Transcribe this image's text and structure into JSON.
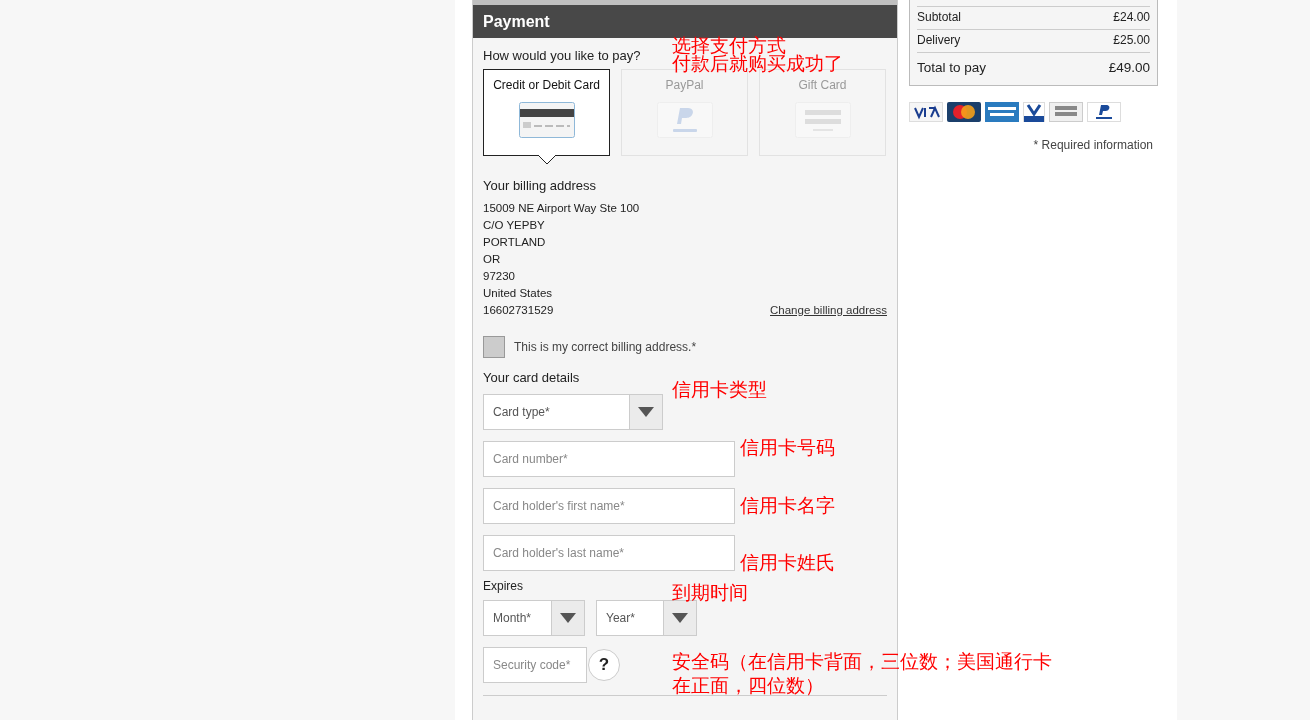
{
  "payment": {
    "title": "Payment",
    "question": "How would you like to pay?",
    "methods": [
      {
        "label": "Credit or Debit Card",
        "kind": "card",
        "selected": true
      },
      {
        "label": "PayPal",
        "kind": "paypal",
        "selected": false
      },
      {
        "label": "Gift Card",
        "kind": "gift",
        "selected": false
      }
    ],
    "billing": {
      "heading": "Your billing address",
      "lines": [
        "15009 NE Airport Way Ste 100",
        "C/O YEPBY",
        "PORTLAND",
        "OR",
        "97230",
        "United States",
        "16602731529"
      ],
      "change_link": "Change billing address"
    },
    "confirm": {
      "label": "This is my correct billing address.*",
      "checked": false
    },
    "card_details": {
      "heading": "Your card details",
      "card_type": {
        "placeholder": "Card type*"
      },
      "card_number": {
        "placeholder": "Card number*"
      },
      "first_name": {
        "placeholder": "Card holder's first name*"
      },
      "last_name": {
        "placeholder": "Card holder's last name*"
      },
      "expires": "Expires",
      "month": {
        "placeholder": "Month*"
      },
      "year": {
        "placeholder": "Year*"
      },
      "security_code": {
        "placeholder": "Security code*"
      },
      "help": "?"
    }
  },
  "summary": {
    "rows": [
      {
        "label": "Subtotal",
        "value": "£24.00"
      },
      {
        "label": "Delivery",
        "value": "£25.00"
      }
    ],
    "total": {
      "label": "Total to pay",
      "value": "£49.00"
    },
    "required_note": "* Required information"
  },
  "annotations": [
    "选择支付方式",
    "付款后就购买成功了",
    "信用卡类型",
    "信用卡号码",
    "信用卡名字",
    "信用卡姓氏",
    "到期时间",
    "安全码（在信用卡背面，三位数；美国通行卡",
    "在正面，四位数）"
  ]
}
